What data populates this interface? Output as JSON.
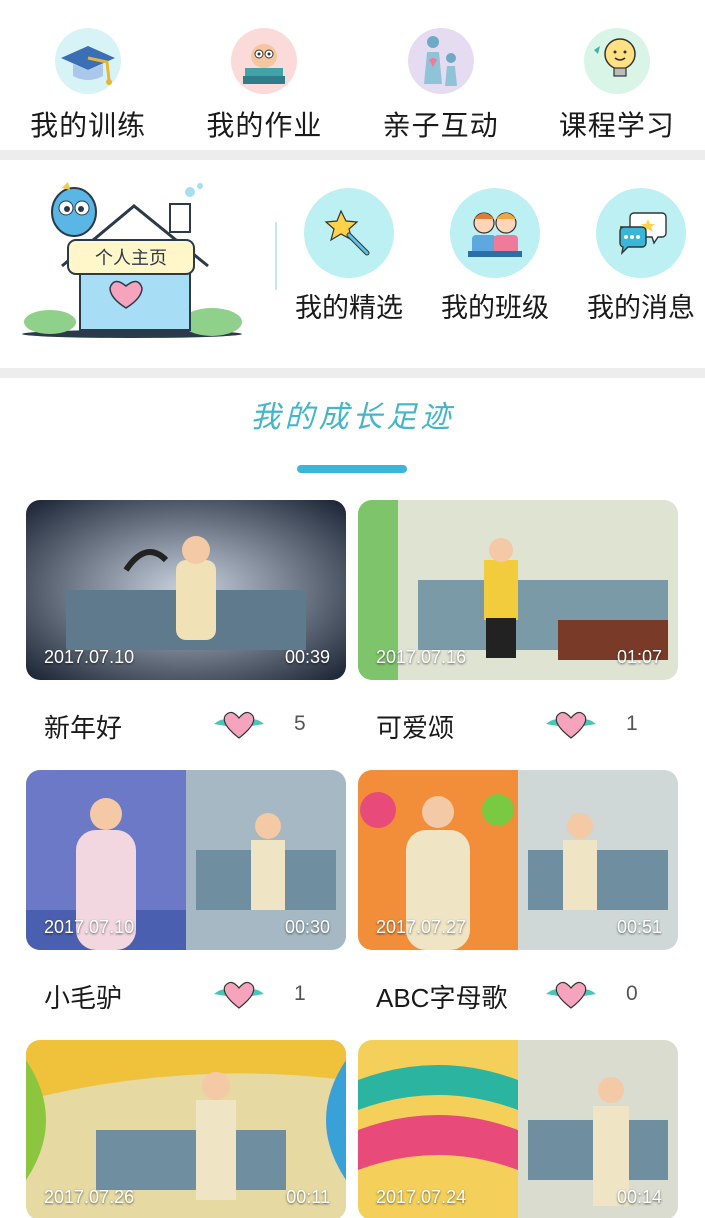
{
  "top_nav": [
    {
      "label": "我的训练",
      "icon": "graduation-cap-icon"
    },
    {
      "label": "我的作业",
      "icon": "owl-books-icon"
    },
    {
      "label": "亲子互动",
      "icon": "parent-child-icon"
    },
    {
      "label": "课程学习",
      "icon": "lightbulb-icon"
    }
  ],
  "homepage": {
    "sign_text": "个人主页",
    "icon": "house-bird-icon"
  },
  "features": [
    {
      "label": "我的精选",
      "icon": "magic-wand-star-icon"
    },
    {
      "label": "我的班级",
      "icon": "classmates-icon"
    },
    {
      "label": "我的消息",
      "icon": "chat-bubbles-icon"
    }
  ],
  "section": {
    "title": "我的成长足迹"
  },
  "videos": [
    {
      "title": "新年好",
      "date": "2017.07.10",
      "duration": "00:39",
      "likes": "5"
    },
    {
      "title": "可爱颂",
      "date": "2017.07.16",
      "duration": "01:07",
      "likes": "1"
    },
    {
      "title": "小毛驴",
      "date": "2017.07.10",
      "duration": "00:30",
      "likes": "1"
    },
    {
      "title": "ABC字母歌",
      "date": "2017.07.27",
      "duration": "00:51",
      "likes": "0"
    },
    {
      "title": "",
      "date": "2017.07.26",
      "duration": "00:11",
      "likes": ""
    },
    {
      "title": "",
      "date": "2017.07.24",
      "duration": "00:14",
      "likes": ""
    }
  ],
  "colors": {
    "accent": "#3ab7d8",
    "title": "#45b5c8",
    "divider": "#ededed",
    "heart": "#f6a3bd"
  }
}
